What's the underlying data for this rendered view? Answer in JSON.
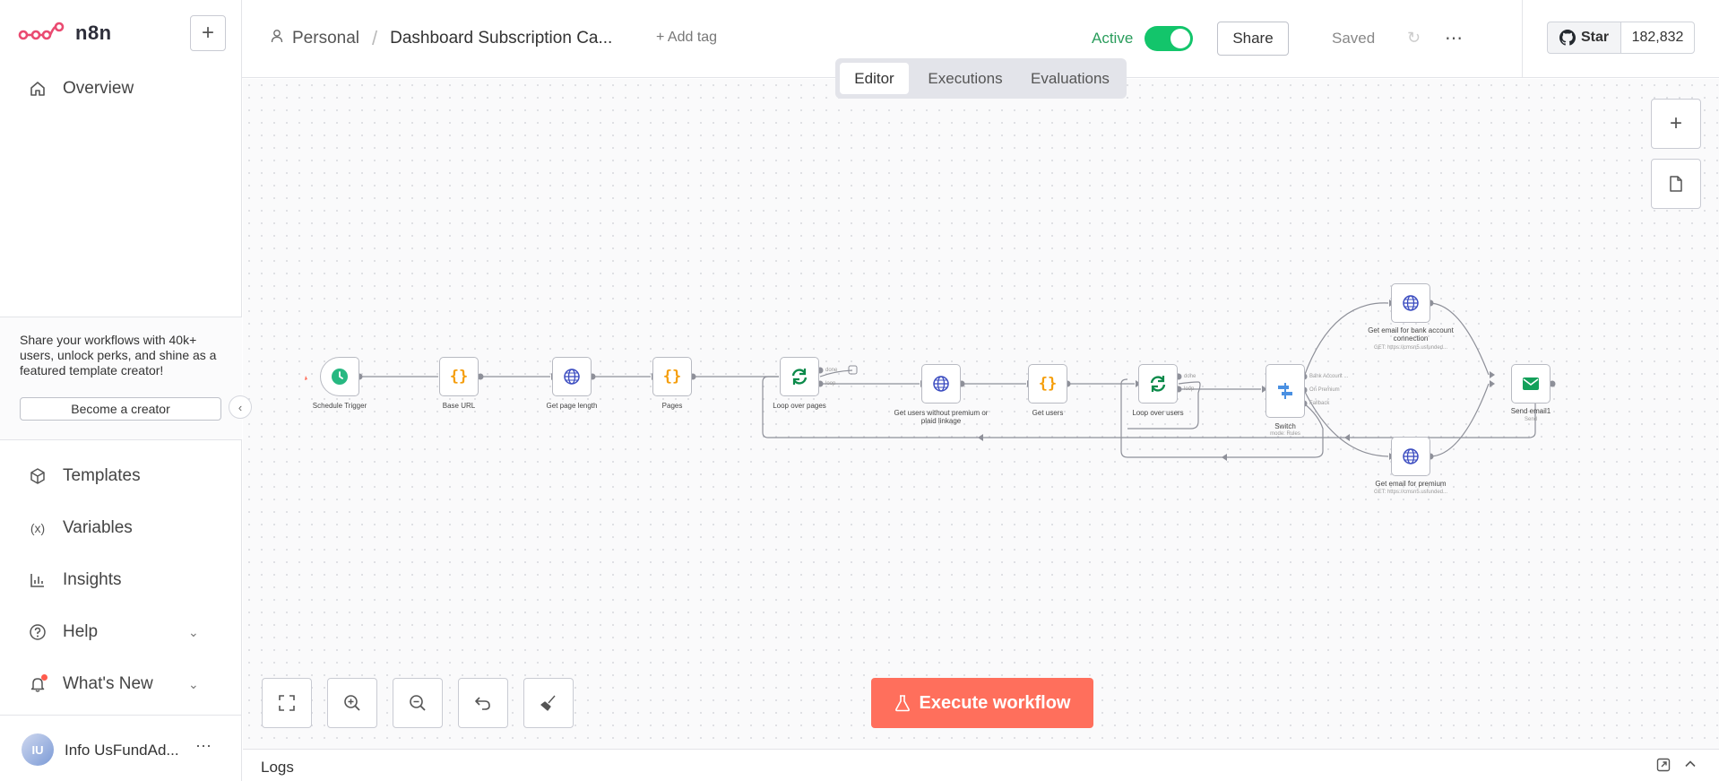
{
  "app": {
    "name": "n8n"
  },
  "sidebar": {
    "nav_top": [
      {
        "label": "Overview"
      }
    ],
    "promo": {
      "text": "Share your workflows with 40k+ users, unlock perks, and shine as a featured template creator!",
      "button": "Become a creator"
    },
    "nav_bottom": [
      {
        "label": "Templates"
      },
      {
        "label": "Variables"
      },
      {
        "label": "Insights"
      },
      {
        "label": "Help"
      },
      {
        "label": "What's New"
      }
    ],
    "user": {
      "initials": "IU",
      "name": "Info UsFundAd..."
    }
  },
  "header": {
    "project": "Personal",
    "workflow_name": "Dashboard Subscription Ca...",
    "add_tag": "+ Add tag",
    "active_label": "Active",
    "share": "Share",
    "saved": "Saved",
    "github_star": "Star",
    "github_count": "182,832"
  },
  "tabs": [
    {
      "label": "Editor",
      "selected": true
    },
    {
      "label": "Executions",
      "selected": false
    },
    {
      "label": "Evaluations",
      "selected": false
    }
  ],
  "nodes": [
    {
      "label": "Schedule Trigger",
      "type": "trigger",
      "icon": "clock-icon",
      "color": "#27b881"
    },
    {
      "label": "Base URL",
      "type": "set",
      "icon": "braces-icon",
      "color": "#f59e0b"
    },
    {
      "label": "Get page length",
      "type": "http",
      "icon": "globe-icon",
      "color": "#3b4cc0"
    },
    {
      "label": "Pages",
      "type": "set",
      "icon": "braces-icon",
      "color": "#f59e0b"
    },
    {
      "label": "Loop over pages",
      "type": "loop",
      "icon": "loop-icon",
      "color": "#0b8a4a"
    },
    {
      "label": "Get users without premium or plaid linkage",
      "type": "http",
      "icon": "globe-icon",
      "color": "#3b4cc0"
    },
    {
      "label": "Get users",
      "type": "set",
      "icon": "braces-icon",
      "color": "#f59e0b"
    },
    {
      "label": "Loop over users",
      "type": "loop",
      "icon": "loop-icon",
      "color": "#0b8a4a"
    },
    {
      "label": "Switch",
      "sub": "mode: Rules",
      "type": "switch",
      "icon": "switch-icon",
      "color": "#4a90e2"
    },
    {
      "label": "Get email for bank account connection",
      "sub": "GET: https://cmsn5.usfunded...",
      "type": "http",
      "icon": "globe-icon",
      "color": "#3b4cc0"
    },
    {
      "label": "Get email for premium",
      "sub": "GET: https://cmsn5.usfunded...",
      "type": "http",
      "icon": "globe-icon",
      "color": "#3b4cc0"
    },
    {
      "label": "Send email1",
      "sub": "Send",
      "type": "email",
      "icon": "mail-icon",
      "color": "#13a05a"
    }
  ],
  "handle_labels": {
    "loop_done": "done",
    "loop_loop": "loop",
    "switch_1": "Bank Account ...",
    "switch_2": "On Premium",
    "switch_3": "Fallback"
  },
  "canvas": {
    "execute_button": "Execute workflow"
  },
  "logs": {
    "title": "Logs"
  },
  "colors": {
    "accent": "#ff6f5c",
    "active": "#13c56b",
    "brand": "#ea4b71"
  }
}
